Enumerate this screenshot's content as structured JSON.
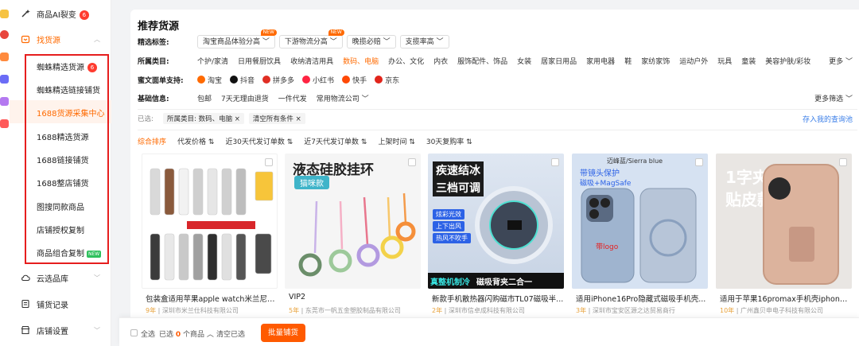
{
  "sidebar": {
    "items": [
      {
        "label": "商品AI裂变",
        "badge": "6"
      },
      {
        "label": "找货源"
      },
      {
        "label": "云选品库"
      },
      {
        "label": "铺货记录"
      },
      {
        "label": "店铺设置"
      }
    ],
    "sub_items": [
      {
        "label": "蜘蛛精选货源",
        "badge": "6"
      },
      {
        "label": "蜘蛛精选链接铺货"
      },
      {
        "label": "1688货源采集中心"
      },
      {
        "label": "1688精选货源"
      },
      {
        "label": "1688链接铺货"
      },
      {
        "label": "1688整店铺货"
      },
      {
        "label": "图搜同款商品"
      },
      {
        "label": "店铺授权复制"
      },
      {
        "label": "商品组合复制",
        "tag": "NEW"
      }
    ]
  },
  "panel": {
    "title": "推荐货源",
    "filters": {
      "tags_label": "精选标签:",
      "tags": [
        {
          "label": "淘宝商品体验分高",
          "new": "NEW"
        },
        {
          "label": "下游物流分高",
          "new": "NEW"
        },
        {
          "label": "晚揽必赔"
        },
        {
          "label": "支揽率高"
        }
      ],
      "category_label": "所属类目:",
      "categories": [
        "个护/家清",
        "日用餐厨饮具",
        "收纳清洁用具",
        "数码、电脑",
        "办公、文化",
        "内衣",
        "服饰配件、饰品",
        "女装",
        "居家日用品",
        "家用电器",
        "鞋",
        "家纺家饰",
        "运动户外",
        "玩具",
        "童装",
        "美容护肤/彩妆"
      ],
      "category_more": "更多",
      "platform_label": "蜜文面单支持:",
      "platforms": [
        {
          "name": "淘宝",
          "color": "#ff6a00"
        },
        {
          "name": "抖音",
          "color": "#111111"
        },
        {
          "name": "拼多多",
          "color": "#e02e24"
        },
        {
          "name": "小红书",
          "color": "#ff2442"
        },
        {
          "name": "快手",
          "color": "#ff4906"
        },
        {
          "name": "京东",
          "color": "#e1251b"
        }
      ],
      "basic_label": "基础信息:",
      "basic": [
        "包邮",
        "7天无理由退货",
        "一件代发",
        "常用物流公司"
      ],
      "more_filter": "更多筛选",
      "selected_label": "已选:",
      "selected": [
        "所属类目: 数码、电脑 ×",
        "清空所有条件 ×"
      ],
      "save_query": "存入我的查询池"
    },
    "sort": [
      "综合排序",
      "代发价格",
      "近30天代发订单数",
      "近7天代发订单数",
      "上架时间",
      "30天复购率"
    ],
    "products": [
      {
        "title": "包装盒适用苹果apple watch米兰尼龙...",
        "years": "9年",
        "company": "深圳市米兰仕科技有限公司"
      },
      {
        "title": "VIP2",
        "years": "5年",
        "company": "东莞市一帆五金塑胶制品有限公司",
        "img_title": "液态硅胶挂环",
        "img_sub": "猫咪款"
      },
      {
        "title": "新款手机散热器闪购磁市TL07磁吸半...",
        "years": "2年",
        "company": "深圳市信卓成科技有限公司",
        "img_title": "疾速结冰",
        "img_sub": "三档可调",
        "img_points": [
          "炫彩光效",
          "上下出风",
          "热风不吹手"
        ],
        "img_foot": [
          "真整机制冷",
          "磁吸背夹二合一"
        ]
      },
      {
        "title": "适用iPhone16Pro隐藏式磁吸手机壳...",
        "years": "3年",
        "company": "深圳市宝安区源之达贸易商行",
        "img_title": "迈峰蓝/Sierra blue",
        "img_sub": "带镜头保护",
        "img_badge": "磁吸+MagSafe",
        "img_logo": "带logo"
      },
      {
        "title": "适用于苹果16promax手机壳iphone1...",
        "years": "10年",
        "company": "广州鑫贝申电子科技有限公司",
        "img_title": "1字夹",
        "img_sub": "贴皮款"
      }
    ]
  },
  "bottom": {
    "select_all": "全选",
    "selected_prefix": "已选",
    "selected_count": "0",
    "selected_suffix": "个商品",
    "clear": "清空已选",
    "batch": "批量铺货"
  }
}
